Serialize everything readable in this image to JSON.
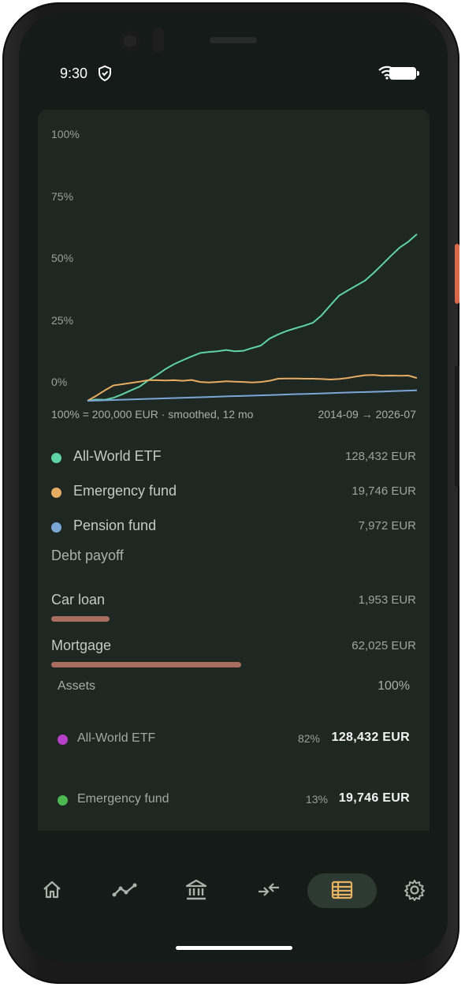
{
  "status_bar": {
    "time": "9:30"
  },
  "chart_data": {
    "type": "line",
    "y_ticks": [
      "100%",
      "75%",
      "50%",
      "25%",
      "0%"
    ],
    "ylim": [
      0,
      100
    ],
    "x_range": [
      "2014-09",
      "2026-07"
    ],
    "caption_left": "100% = 200,000 EUR · smoothed, 12 mo",
    "caption_right": "2014-09 → 2026-07",
    "series": [
      {
        "name": "All-World ETF",
        "color": "#5fd3a4",
        "values": [
          -3.5,
          -3,
          -3.1,
          -2.3,
          -0.9,
          0.7,
          2.2,
          4.7,
          6.9,
          9.3,
          11.3,
          12.9,
          14.4,
          15.8,
          16.2,
          16.5,
          17,
          16.5,
          16.7,
          17.8,
          18.8,
          21.6,
          23.3,
          24.7,
          25.8,
          26.8,
          28,
          31,
          35,
          38.9,
          41,
          43,
          45,
          48.1,
          51.5,
          55,
          58.3,
          60.7,
          63.8
        ]
      },
      {
        "name": "Emergency fund",
        "color": "#e6ac62",
        "values": [
          -3.5,
          -1.5,
          0.7,
          2.7,
          3.2,
          3.7,
          4.2,
          4.8,
          4.8,
          4.7,
          4.8,
          4.6,
          4.9,
          4.1,
          3.9,
          4.1,
          4.4,
          4.2,
          4.1,
          3.9,
          4.1,
          4.6,
          5.4,
          5.5,
          5.5,
          5.4,
          5.4,
          5.3,
          5.1,
          5.3,
          5.7,
          6.3,
          6.8,
          6.9,
          6.6,
          6.7,
          6.6,
          6.7,
          5.7
        ]
      },
      {
        "name": "Pension fund",
        "color": "#7ba6d6",
        "values": [
          -3.5,
          -3.3,
          -3.1,
          -2.9,
          -2.7,
          -2.5,
          -2.3,
          -2.1,
          -1.9,
          -1.7,
          -1.5,
          -1.3,
          -1.1,
          -0.9,
          -0.7,
          -0.5,
          -0.3,
          -0.1,
          0.1,
          0.3,
          0.5,
          0.7
        ]
      }
    ]
  },
  "legend": [
    {
      "name": "All-World ETF",
      "value": "128,432 EUR",
      "color": "#5fd3a4"
    },
    {
      "name": "Emergency fund",
      "value": "19,746 EUR",
      "color": "#e6ac62"
    },
    {
      "name": "Pension fund",
      "value": "7,972 EUR",
      "color": "#7ba6d6"
    }
  ],
  "debt": {
    "title": "Debt payoff",
    "items": [
      {
        "name": "Car loan",
        "value": "1,953 EUR",
        "bar_fraction": 0.16
      },
      {
        "name": "Mortgage",
        "value": "62,025 EUR",
        "bar_fraction": 0.52
      }
    ]
  },
  "assets": {
    "title": "Assets",
    "total_pct": "100%",
    "items": [
      {
        "name": "All-World ETF",
        "pct": "82%",
        "value": "128,432 EUR",
        "color": "#b640c8"
      },
      {
        "name": "Emergency fund",
        "pct": "13%",
        "value": "19,746 EUR",
        "color": "#4cb84f"
      }
    ]
  },
  "nav": {
    "items": [
      {
        "icon": "home-icon"
      },
      {
        "icon": "trend-icon"
      },
      {
        "icon": "bank-icon"
      },
      {
        "icon": "transfer-icon"
      },
      {
        "icon": "list-icon",
        "active": true
      },
      {
        "icon": "settings-icon"
      }
    ],
    "active_color": "#e8b264",
    "icon_color": "#a9b3ad"
  }
}
